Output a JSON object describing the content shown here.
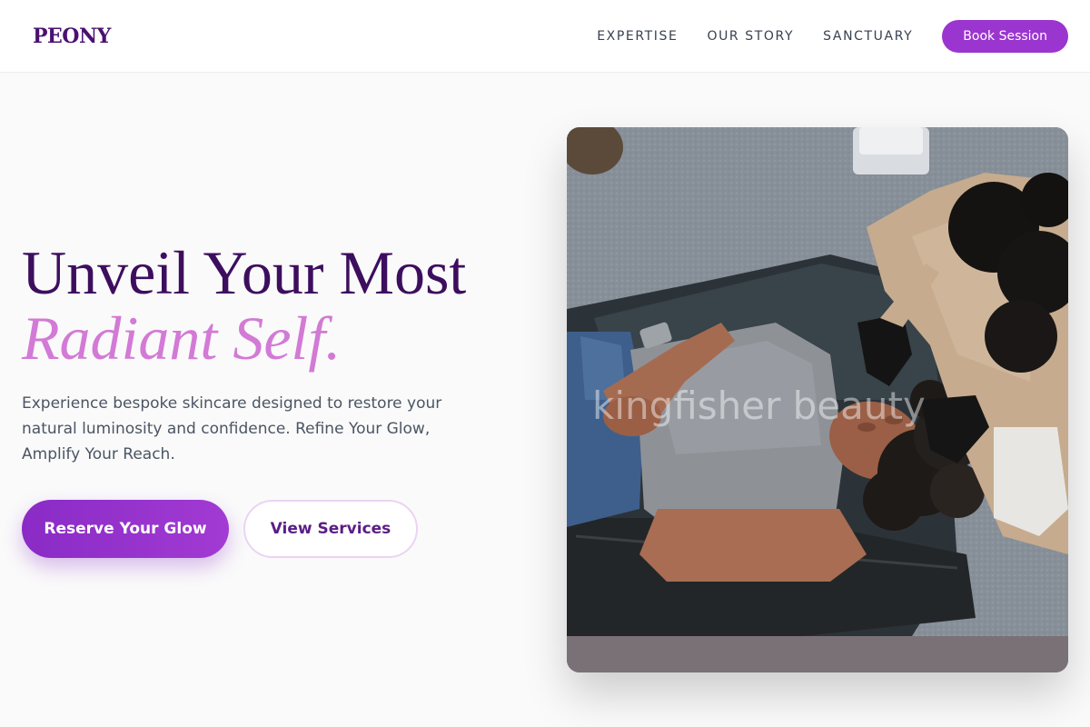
{
  "brand": {
    "name": "PEONY"
  },
  "nav": {
    "links": [
      "EXPERTISE",
      "OUR STORY",
      "SANCTUARY"
    ],
    "cta": "Book Session"
  },
  "hero": {
    "headline_line1": "Unveil Your Most",
    "headline_line2": "Radiant Self.",
    "subtitle": "Experience bespoke skincare designed to restore your natural luminosity and confidence. Refine Your Glow, Amplify Your Reach.",
    "primary_cta": "Reserve Your Glow",
    "secondary_cta": "View Services",
    "image_watermark": "kingfisher beauty"
  },
  "colors": {
    "brand_deep": "#3d0e5e",
    "accent_purple": "#9b35cf",
    "accent_pink": "#d27ad6"
  }
}
